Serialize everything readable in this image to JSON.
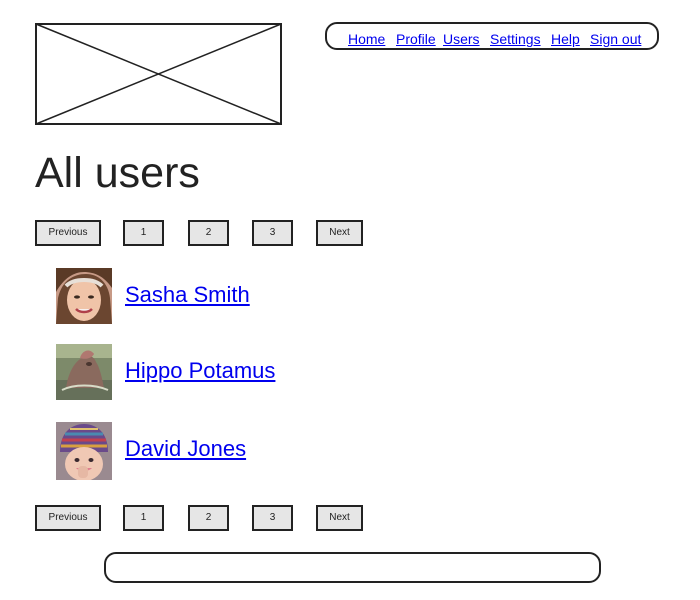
{
  "logo": {
    "icon": "image-placeholder-icon"
  },
  "nav": {
    "home": "Home",
    "profile": "Profile",
    "users": "Users",
    "settings": "Settings",
    "help": "Help",
    "sign_out": "Sign out"
  },
  "page": {
    "title": "All users"
  },
  "pagination": {
    "previous": "Previous",
    "page_1": "1",
    "page_2": "2",
    "page_3": "3",
    "next": "Next"
  },
  "users": [
    {
      "name": "Sasha Smith",
      "avatar": "woman-headband-avatar"
    },
    {
      "name": "Hippo Potamus",
      "avatar": "hippo-avatar"
    },
    {
      "name": "David Jones",
      "avatar": "child-knit-hat-avatar"
    }
  ],
  "colors": {
    "link": "#0000ee",
    "border": "#222222",
    "button_bg": "#e6e6e6"
  }
}
